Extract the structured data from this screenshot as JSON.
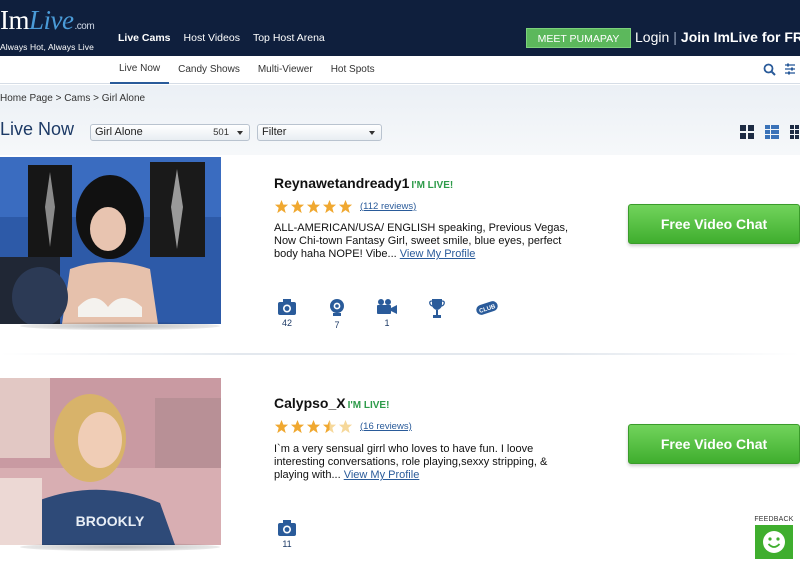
{
  "brand": {
    "logo_prefix": "Im",
    "logo_highlight": "Live",
    "logo_domain": ".com",
    "tagline": "Always Hot, Always Live"
  },
  "top_nav": {
    "items": [
      {
        "label": "Live Cams",
        "active": true
      },
      {
        "label": "Host Videos",
        "active": false
      },
      {
        "label": "Top Host Arena",
        "active": false
      }
    ],
    "meet_button": "MEET PUMAPAY",
    "login": "Login",
    "join": "Join ImLive for FREE"
  },
  "sub_nav": {
    "items": [
      {
        "label": "Live Now",
        "active": true
      },
      {
        "label": "Candy Shows",
        "active": false
      },
      {
        "label": "Multi-Viewer",
        "active": false
      },
      {
        "label": "Hot Spots",
        "active": false
      }
    ],
    "icons": [
      "search-icon",
      "filter-settings-icon"
    ]
  },
  "breadcrumb": "Home Page > Cams > Girl Alone",
  "page_title": "Live Now",
  "category_select": {
    "value": "Girl Alone",
    "count": "501"
  },
  "filter_select": {
    "value": "Filter"
  },
  "view_modes": [
    "grid-large-view-icon",
    "list-view-icon",
    "grid-small-view-icon"
  ],
  "listings": [
    {
      "name": "Reynawetandready1",
      "live_label": "I'M LIVE!",
      "rating": 5,
      "reviews": "(112 reviews)",
      "description": "ALL-AMERICAN/USA/ ENGLISH speaking, Previous Vegas, Now Chi-town Fantasy Girl, sweet smile, blue eyes, perfect body haha NOPE! Vibe...",
      "profile_link": "View My Profile",
      "cta": "Free Video Chat",
      "stats": [
        {
          "icon": "photo-camera-icon",
          "count": "42"
        },
        {
          "icon": "webcam-icon",
          "count": "7"
        },
        {
          "icon": "video-camera-icon",
          "count": "1"
        },
        {
          "icon": "trophy-icon",
          "count": ""
        },
        {
          "icon": "club-badge-icon",
          "count": "",
          "label": "CLUB"
        }
      ]
    },
    {
      "name": "Calypso_X",
      "live_label": "I'M LIVE!",
      "rating": 3.5,
      "reviews": "(16 reviews)",
      "description": "I`m a very sensual girrl who loves to have fun. I loove interesting conversations, role playing,sexxy stripping, & playing with...",
      "profile_link": "View My Profile",
      "cta": "Free Video Chat",
      "stats": [
        {
          "icon": "photo-camera-icon",
          "count": "11"
        }
      ]
    }
  ],
  "feedback": {
    "label": "FEEDBACK",
    "icon": "smiley-icon"
  },
  "colors": {
    "topbar": "#0f1f3d",
    "accent_blue": "#2a5b9a",
    "cta_green": "#3fae2e",
    "live_green": "#2e9b4a",
    "star_gold": "#f0a830"
  }
}
